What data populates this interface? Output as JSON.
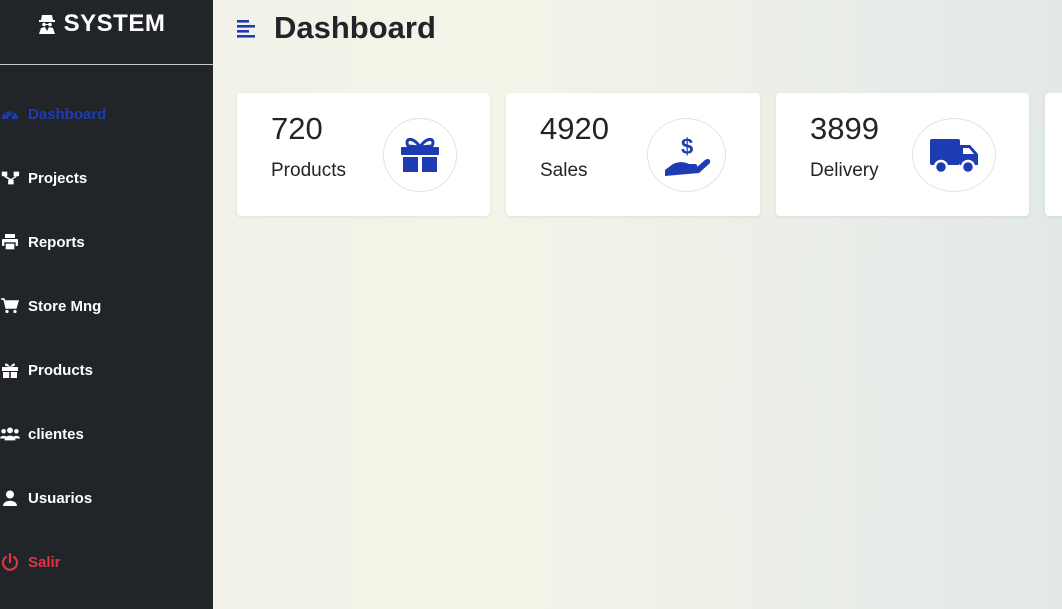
{
  "brand": {
    "title": "SYSTEM",
    "icon": "user-secret-icon"
  },
  "header": {
    "title": "Dashboard",
    "menu_icon": "menu-align-icon"
  },
  "sidebar": {
    "items": [
      {
        "label": "Dashboard",
        "icon": "tachometer-icon",
        "state": "active"
      },
      {
        "label": "Projects",
        "icon": "sitemap-icon"
      },
      {
        "label": "Reports",
        "icon": "printer-icon"
      },
      {
        "label": "Store Mng",
        "icon": "cart-icon"
      },
      {
        "label": "Products",
        "icon": "gift-icon"
      },
      {
        "label": "clientes",
        "icon": "users-icon"
      },
      {
        "label": "Usuarios",
        "icon": "user-icon"
      },
      {
        "label": "Salir",
        "icon": "power-icon",
        "state": "danger"
      }
    ]
  },
  "cards": [
    {
      "value": "720",
      "label": "Products",
      "icon": "gift-icon"
    },
    {
      "value": "4920",
      "label": "Sales",
      "icon": "hand-dollar-icon"
    },
    {
      "value": "3899",
      "label": "Delivery",
      "icon": "truck-icon"
    }
  ],
  "colors": {
    "accent": "#1d3bb3",
    "sidebar_bg": "#212529",
    "danger": "#dc3545"
  }
}
